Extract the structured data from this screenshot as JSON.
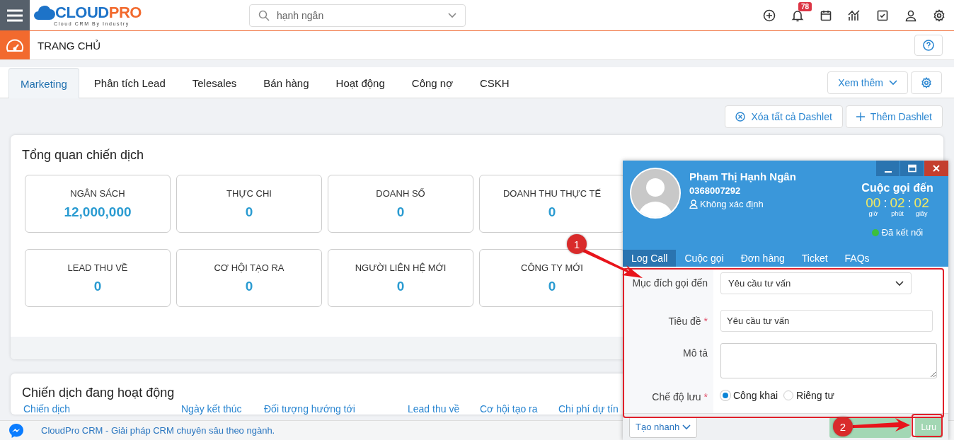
{
  "topbar": {
    "logo": {
      "brand_a": "CLOUD",
      "brand_b": "PRO",
      "tagline": "Cloud CRM By Industry"
    },
    "search": {
      "value": "hạnh ngân"
    },
    "notification_count": "78"
  },
  "breadcrumb": {
    "title": "TRANG CHỦ"
  },
  "tabs": [
    {
      "label": "Marketing",
      "selected": true
    },
    {
      "label": "Phân tích Lead",
      "selected": false
    },
    {
      "label": "Telesales",
      "selected": false
    },
    {
      "label": "Bán hàng",
      "selected": false
    },
    {
      "label": "Hoạt động",
      "selected": false
    },
    {
      "label": "Công nợ",
      "selected": false
    },
    {
      "label": "CSKH",
      "selected": false
    }
  ],
  "more_button": "Xem thêm",
  "dashlet_actions": [
    {
      "kind": "clear",
      "label": "Xóa tất cả Dashlet"
    },
    {
      "kind": "add",
      "label": "Thêm Dashlet"
    }
  ],
  "overview": {
    "title": "Tổng quan chiến dịch",
    "stats": [
      {
        "label": "NGÂN SÁCH",
        "value": "12,000,000"
      },
      {
        "label": "THỰC CHI",
        "value": "0"
      },
      {
        "label": "DOANH SỐ",
        "value": "0"
      },
      {
        "label": "DOANH THU THỰC TẾ",
        "value": "0"
      },
      {
        "label": "LEAD THU VỀ",
        "value": "0"
      },
      {
        "label": "CƠ HỘI TẠO RA",
        "value": "0"
      },
      {
        "label": "NGƯỜI LIÊN HỆ MỚI",
        "value": "0"
      },
      {
        "label": "CÔNG TY MỚI",
        "value": "0"
      }
    ]
  },
  "active_campaigns": {
    "title": "Chiến dịch đang hoạt động",
    "columns": [
      "Chiến dịch",
      "Ngày kết thúc",
      "Đối tượng hướng tới",
      "Lead thu về",
      "Cơ hội tạo ra",
      "Chi phí dự tín"
    ]
  },
  "footer": {
    "text": "CloudPro CRM - Giải pháp CRM chuyên sâu theo ngành."
  },
  "call_popup": {
    "name": "Phạm Thị Hạnh Ngân",
    "phone": "0368007292",
    "contact_type": "Không xác định",
    "call_title": "Cuộc gọi đến",
    "timer": [
      {
        "kind": "digit",
        "value": "00",
        "unit": "giờ"
      },
      {
        "kind": "sep",
        "value": ":"
      },
      {
        "kind": "digit",
        "value": "02",
        "unit": "phút"
      },
      {
        "kind": "sep",
        "value": ":"
      },
      {
        "kind": "digit",
        "value": "02",
        "unit": "giây"
      }
    ],
    "status": {
      "label": "Đã kết nối",
      "connected": true
    },
    "tabs": [
      {
        "label": "Log Call",
        "selected": true
      },
      {
        "label": "Cuộc gọi",
        "selected": false
      },
      {
        "label": "Đơn hàng",
        "selected": false
      },
      {
        "label": "Ticket",
        "selected": false
      },
      {
        "label": "FAQs",
        "selected": false
      }
    ],
    "form": {
      "purpose": {
        "label": "Mục đích gọi đến",
        "value": "Yêu cầu tư vấn"
      },
      "title": {
        "label": "Tiêu đề",
        "required_mark": "*",
        "value": "Yêu cầu tư vấn"
      },
      "description": {
        "label": "Mô tả"
      },
      "save_mode": {
        "label": "Chế độ lưu",
        "required_mark": "*",
        "options": [
          {
            "label": "Công khai",
            "selected": true
          },
          {
            "label": "Riêng tư",
            "selected": false
          }
        ]
      }
    },
    "quick_create": "Tạo nhanh",
    "save": "Lưu"
  },
  "annotations": [
    {
      "number": "1"
    },
    {
      "number": "2"
    }
  ]
}
